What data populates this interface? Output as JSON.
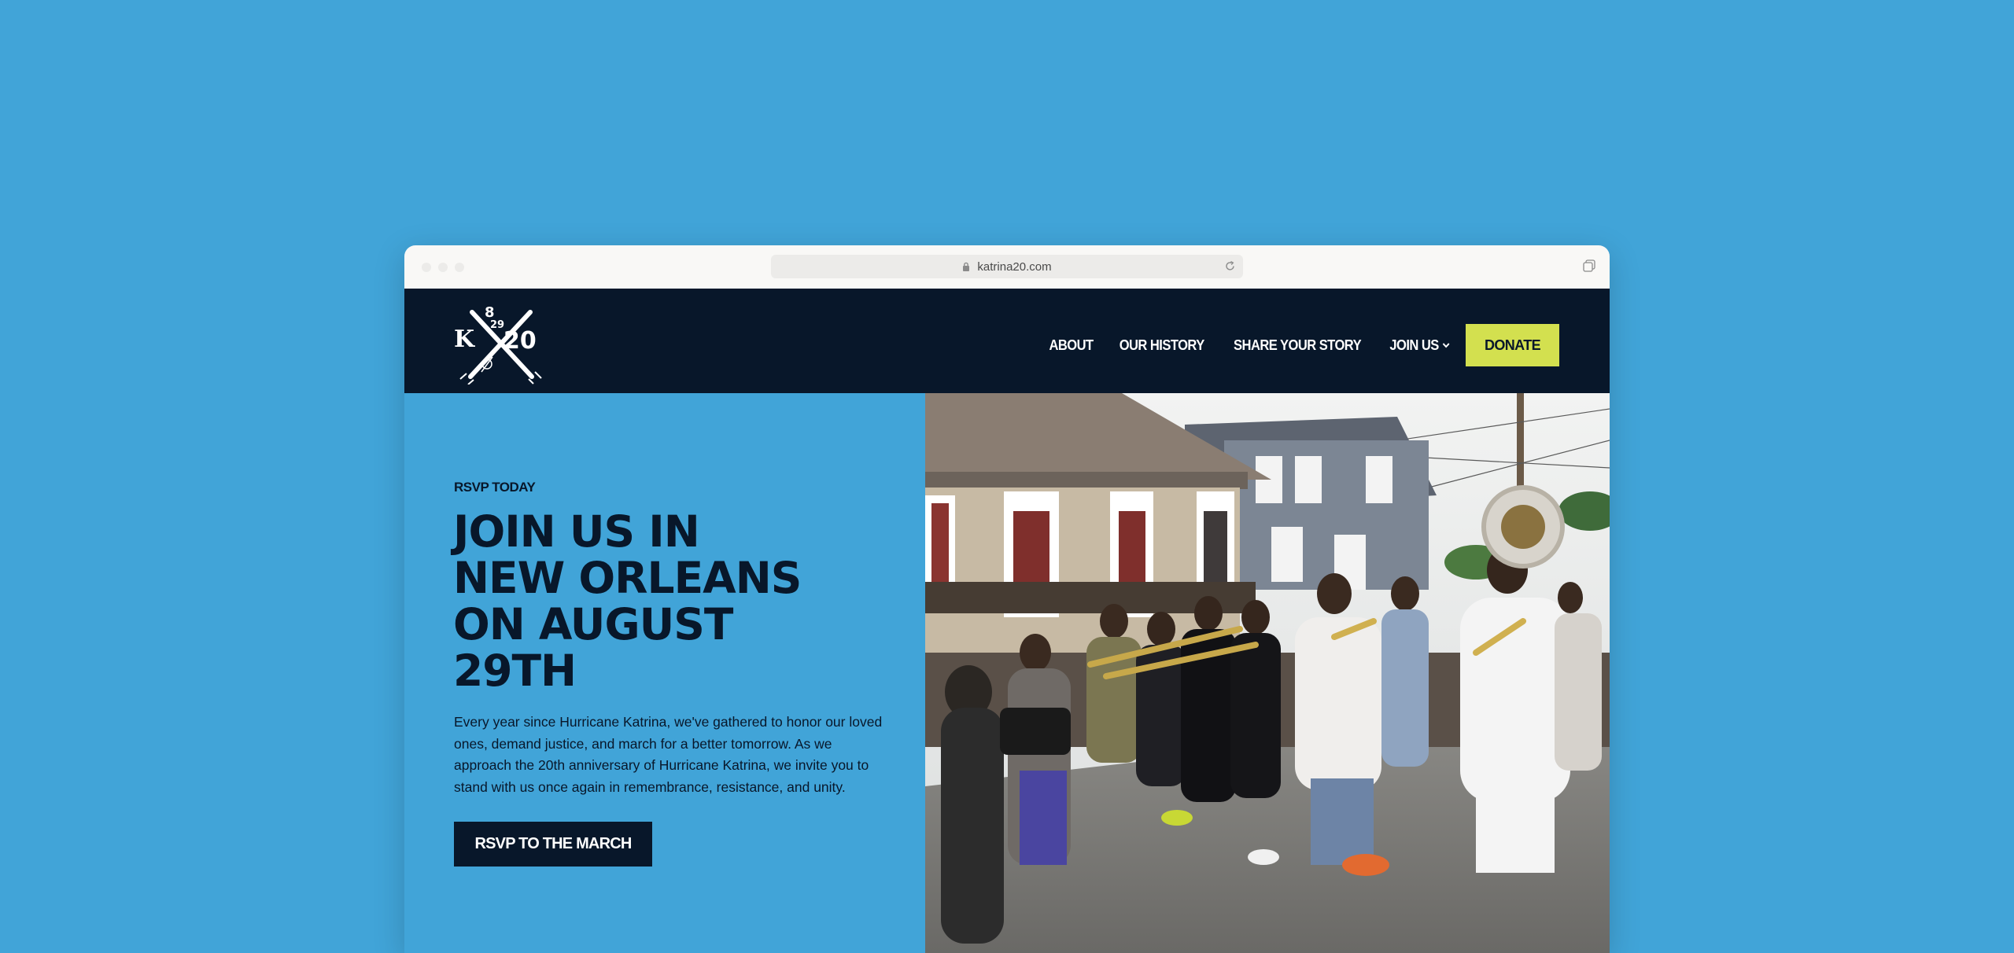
{
  "browser": {
    "url": "katrina20.com"
  },
  "header": {
    "logo": {
      "letter": "K",
      "month": "8",
      "day": "29",
      "number": "20"
    },
    "nav": {
      "about": "ABOUT",
      "history": "OUR HISTORY",
      "share": "SHARE YOUR STORY",
      "join": "JOIN US",
      "donate": "DONATE"
    }
  },
  "hero": {
    "eyebrow": "RSVP TODAY",
    "headline_lines": [
      "JOIN US IN",
      "NEW ORLEANS",
      "ON AUGUST",
      "29TH"
    ],
    "body": "Every year since Hurricane Katrina, we've gathered to honor our loved ones, demand justice, and march for a better tomorrow. As we approach the 20th anniversary of Hurricane Katrina, we invite you to stand with us once again in remembrance, resistance, and unity.",
    "cta": "RSVP TO THE MARCH",
    "photo_alt": "Brass band second line parade marching down a New Orleans street"
  },
  "colors": {
    "background": "#41a4d8",
    "navy": "#08172a",
    "accent": "#d3e04f",
    "chrome": "#f9f8f6"
  }
}
